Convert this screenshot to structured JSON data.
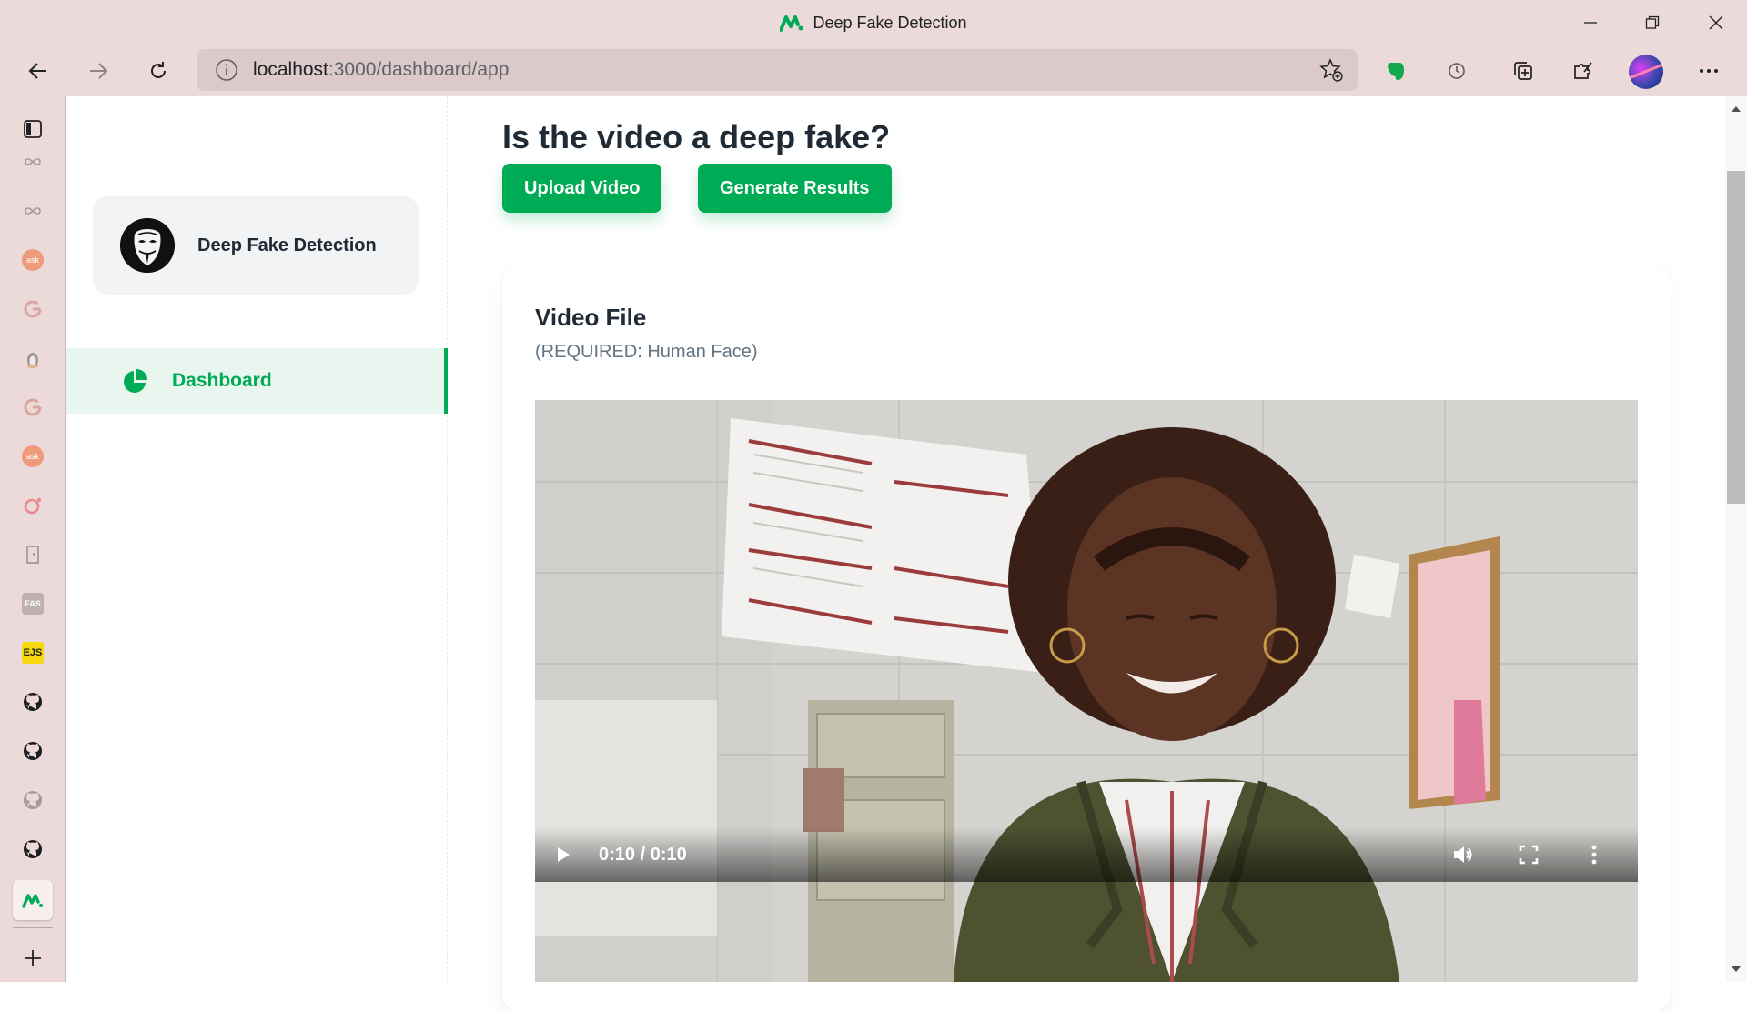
{
  "window": {
    "title": "Deep Fake Detection",
    "controls": [
      "minimize-icon",
      "restore-icon",
      "close-icon"
    ]
  },
  "toolbar": {
    "url_host": "localhost",
    "url_rest": ":3000/dashboard/app",
    "icons": [
      "back-icon",
      "forward-icon",
      "refresh-icon",
      "info-icon",
      "favorites-add-icon",
      "evernote-icon",
      "history-icon",
      "collections-icon",
      "extensions-icon",
      "profile-avatar",
      "more-icon"
    ]
  },
  "browser_sidebar": {
    "items": [
      {
        "name": "tab-sidebar-icon"
      },
      {
        "name": "chatgpt-icon"
      },
      {
        "name": "chatgpt-icon"
      },
      {
        "name": "askfm-icon",
        "text": "ask"
      },
      {
        "name": "google-icon"
      },
      {
        "name": "linux-icon"
      },
      {
        "name": "google-icon"
      },
      {
        "name": "askfm-icon",
        "text": "ask"
      },
      {
        "name": "opera-icon"
      },
      {
        "name": "document-icon"
      },
      {
        "name": "fas-icon",
        "text": "FAS"
      },
      {
        "name": "ejs-icon",
        "text": "EJS"
      },
      {
        "name": "github-icon"
      },
      {
        "name": "github-icon"
      },
      {
        "name": "github-icon"
      },
      {
        "name": "github-icon"
      },
      {
        "name": "app-icon"
      }
    ],
    "add_label": "+"
  },
  "nav": {
    "account_name": "Deep Fake Detection",
    "items": [
      {
        "label": "Dashboard",
        "icon": "pie-chart-icon",
        "active": true
      }
    ]
  },
  "main": {
    "heading": "Is the video a deep fake?",
    "upload_label": "Upload Video",
    "generate_label": "Generate Results",
    "card_title": "Video File",
    "card_subtitle": "(REQUIRED: Human Face)",
    "video": {
      "time": "0:10 / 0:10",
      "controls": [
        "play-icon",
        "volume-icon",
        "fullscreen-icon",
        "more-vert-icon"
      ]
    }
  },
  "colors": {
    "accent": "#00ab55",
    "accent_bg": "#e9f6ef",
    "browser_chrome": "#ecd9d9",
    "heading": "#212b36",
    "muted": "#637381"
  }
}
